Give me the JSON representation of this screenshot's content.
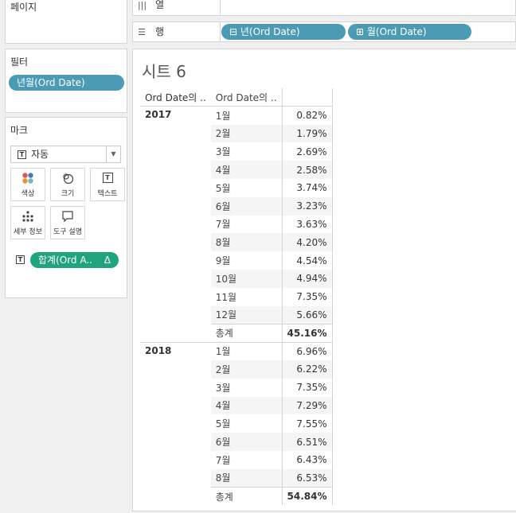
{
  "left": {
    "pages_title": "페이지",
    "filters_title": "필터",
    "filter_pill": "년월(Ord Date)",
    "marks_title": "마크",
    "mark_type": "자동",
    "mark_buttons": [
      {
        "label": "색상",
        "icon": "color-dots-icon"
      },
      {
        "label": "크기",
        "icon": "size-icon"
      },
      {
        "label": "텍스트",
        "icon": "text-icon"
      },
      {
        "label": "세부 정보",
        "icon": "detail-icon"
      },
      {
        "label": "도구 설명",
        "icon": "tooltip-icon"
      }
    ],
    "measure_pill": "합계(Ord A..",
    "measure_delta": "Δ"
  },
  "shelves": {
    "columns_label": "열",
    "rows_label": "행",
    "row_pill_1": "년(Ord Date)",
    "row_pill_2": "월(Ord Date)"
  },
  "sheet": {
    "title": "시트 6",
    "col_header_1": "Ord Date의 ..",
    "col_header_2": "Ord Date의 .."
  },
  "table": {
    "years": [
      {
        "year": "2017",
        "rows": [
          {
            "month": "1월",
            "value": "0.82%"
          },
          {
            "month": "2월",
            "value": "1.79%"
          },
          {
            "month": "3월",
            "value": "2.69%"
          },
          {
            "month": "4월",
            "value": "2.58%"
          },
          {
            "month": "5월",
            "value": "3.74%"
          },
          {
            "month": "6월",
            "value": "3.23%"
          },
          {
            "month": "7월",
            "value": "3.63%"
          },
          {
            "month": "8월",
            "value": "4.20%"
          },
          {
            "month": "9월",
            "value": "4.54%"
          },
          {
            "month": "10월",
            "value": "4.94%"
          },
          {
            "month": "11월",
            "value": "7.35%"
          },
          {
            "month": "12월",
            "value": "5.66%"
          }
        ],
        "total_label": "총계",
        "total": "45.16%"
      },
      {
        "year": "2018",
        "rows": [
          {
            "month": "1월",
            "value": "6.96%"
          },
          {
            "month": "2월",
            "value": "6.22%"
          },
          {
            "month": "3월",
            "value": "7.35%"
          },
          {
            "month": "4월",
            "value": "7.29%"
          },
          {
            "month": "5월",
            "value": "7.55%"
          },
          {
            "month": "6월",
            "value": "6.51%"
          },
          {
            "month": "7월",
            "value": "6.43%"
          },
          {
            "month": "8월",
            "value": "6.53%"
          }
        ],
        "total_label": "총계",
        "total": "54.84%"
      }
    ]
  },
  "colors": {
    "pill_blue": "#4b9bb5",
    "pill_green": "#1fa57c"
  }
}
